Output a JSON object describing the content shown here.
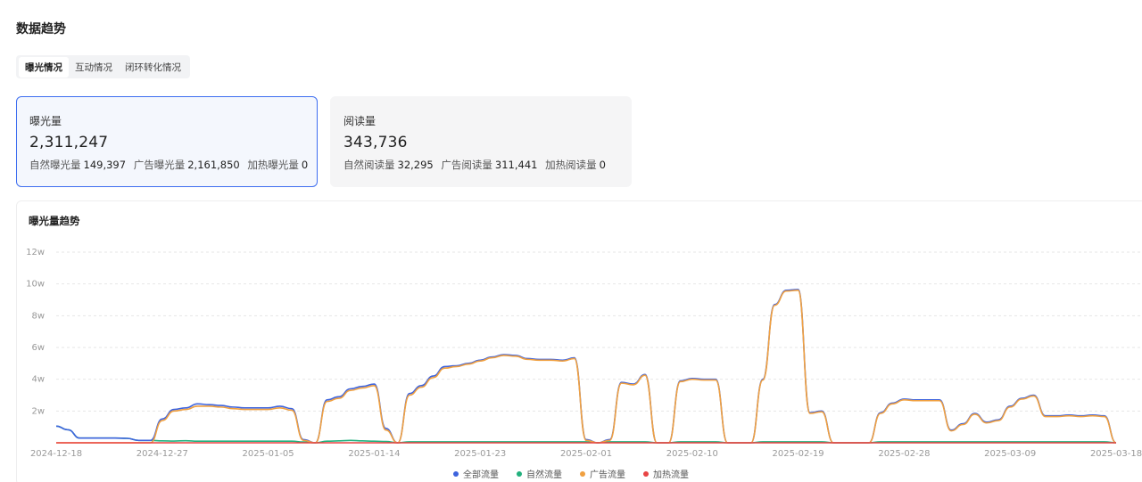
{
  "page": {
    "title": "数据趋势"
  },
  "tabs": [
    {
      "label": "曝光情况",
      "active": true
    },
    {
      "label": "互动情况",
      "active": false
    },
    {
      "label": "闭环转化情况",
      "active": false
    }
  ],
  "cards": [
    {
      "title": "曝光量",
      "value": "2,311,247",
      "breakdown": [
        {
          "label": "自然曝光量",
          "value": "149,397"
        },
        {
          "label": "广告曝光量",
          "value": "2,161,850"
        },
        {
          "label": "加热曝光量",
          "value": "0"
        }
      ]
    },
    {
      "title": "阅读量",
      "value": "343,736",
      "breakdown": [
        {
          "label": "自然阅读量",
          "value": "32,295"
        },
        {
          "label": "广告阅读量",
          "value": "311,441"
        },
        {
          "label": "加热阅读量",
          "value": "0"
        }
      ]
    }
  ],
  "chart_data": {
    "type": "line",
    "title": "曝光量趋势",
    "ylim": [
      0,
      120000
    ],
    "yticks": [
      {
        "v": 20000,
        "label": "2w"
      },
      {
        "v": 40000,
        "label": "4w"
      },
      {
        "v": 60000,
        "label": "6w"
      },
      {
        "v": 80000,
        "label": "8w"
      },
      {
        "v": 100000,
        "label": "10w"
      },
      {
        "v": 120000,
        "label": "12w"
      }
    ],
    "xlabels": [
      "2024-12-18",
      "2024-12-27",
      "2025-01-05",
      "2025-01-14",
      "2025-01-23",
      "2025-02-01",
      "2025-02-10",
      "2025-02-19",
      "2025-02-28",
      "2025-03-09",
      "2025-03-18"
    ],
    "x": [
      "12-18",
      "12-19",
      "12-20",
      "12-21",
      "12-22",
      "12-23",
      "12-24",
      "12-25",
      "12-26",
      "12-27",
      "12-28",
      "12-29",
      "12-30",
      "12-31",
      "01-01",
      "01-02",
      "01-03",
      "01-04",
      "01-05",
      "01-06",
      "01-07",
      "01-08",
      "01-09",
      "01-10",
      "01-11",
      "01-12",
      "01-13",
      "01-14",
      "01-15",
      "01-16",
      "01-17",
      "01-18",
      "01-19",
      "01-20",
      "01-21",
      "01-22",
      "01-23",
      "01-24",
      "01-25",
      "01-26",
      "01-27",
      "01-28",
      "01-29",
      "01-30",
      "01-31",
      "02-01",
      "02-02",
      "02-03",
      "02-04",
      "02-05",
      "02-06",
      "02-07",
      "02-08",
      "02-09",
      "02-10",
      "02-11",
      "02-12",
      "02-13",
      "02-14",
      "02-15",
      "02-16",
      "02-17",
      "02-18",
      "02-19",
      "02-20",
      "02-21",
      "02-22",
      "02-23",
      "02-24",
      "02-25",
      "02-26",
      "02-27",
      "02-28",
      "03-01",
      "03-02",
      "03-03",
      "03-04",
      "03-05",
      "03-06",
      "03-07",
      "03-08",
      "03-09",
      "03-10",
      "03-11",
      "03-12",
      "03-13",
      "03-14",
      "03-15",
      "03-16",
      "03-17",
      "03-18"
    ],
    "series": [
      {
        "name": "全部流量",
        "color": "#3d63dd",
        "values": [
          10500,
          8200,
          3000,
          3000,
          3000,
          3000,
          2800,
          1500,
          1500,
          15000,
          21000,
          22000,
          24500,
          24000,
          23500,
          22500,
          22000,
          22000,
          22000,
          23000,
          21500,
          2000,
          0,
          27000,
          29000,
          34000,
          35500,
          37000,
          9000,
          0,
          31000,
          36000,
          42000,
          48000,
          48500,
          50000,
          52000,
          54000,
          55500,
          55000,
          53000,
          52500,
          52500,
          52000,
          53500,
          2000,
          0,
          2000,
          38000,
          37000,
          43000,
          0,
          0,
          39000,
          40500,
          40000,
          40000,
          0,
          0,
          0,
          40000,
          87000,
          96000,
          96500,
          19000,
          20000,
          0,
          0,
          0,
          0,
          19000,
          25000,
          27500,
          27000,
          27000,
          27000,
          8000,
          12000,
          18500,
          13000,
          14500,
          23000,
          28000,
          30000,
          17000,
          17000,
          17500,
          17000,
          17500,
          17000,
          0
        ]
      },
      {
        "name": "自然流量",
        "color": "#22b07d",
        "values": [
          10500,
          8200,
          3000,
          3000,
          3000,
          3000,
          2800,
          1500,
          1500,
          1200,
          1100,
          1300,
          1000,
          1000,
          1000,
          1000,
          1000,
          1000,
          1000,
          1000,
          1000,
          500,
          0,
          1000,
          1200,
          1500,
          1200,
          1000,
          800,
          0,
          600,
          600,
          600,
          600,
          600,
          600,
          600,
          600,
          600,
          600,
          600,
          600,
          600,
          600,
          600,
          600,
          0,
          600,
          600,
          600,
          600,
          0,
          0,
          600,
          600,
          600,
          600,
          0,
          0,
          0,
          600,
          600,
          600,
          600,
          600,
          600,
          0,
          0,
          0,
          0,
          600,
          600,
          600,
          600,
          600,
          600,
          600,
          600,
          600,
          600,
          600,
          600,
          600,
          600,
          600,
          600,
          600,
          600,
          600,
          600,
          0
        ]
      },
      {
        "name": "广告流量",
        "color": "#f0a040",
        "values": [
          0,
          0,
          0,
          0,
          0,
          0,
          0,
          0,
          0,
          14000,
          20000,
          21000,
          23000,
          23000,
          22500,
          21500,
          21000,
          21000,
          21000,
          22000,
          20500,
          1500,
          0,
          26000,
          28000,
          33000,
          34500,
          36000,
          8000,
          0,
          30000,
          35000,
          41000,
          47000,
          48000,
          49500,
          51500,
          53500,
          55000,
          54500,
          52500,
          52000,
          52000,
          51500,
          53000,
          1500,
          0,
          1500,
          37500,
          36500,
          42500,
          0,
          0,
          38500,
          40000,
          39500,
          39500,
          0,
          0,
          0,
          39500,
          86500,
          95500,
          96000,
          18500,
          19500,
          0,
          0,
          0,
          0,
          18500,
          24500,
          27000,
          26500,
          26500,
          26500,
          7500,
          11500,
          18000,
          12500,
          14000,
          22500,
          27500,
          29500,
          16500,
          16500,
          17000,
          16500,
          17000,
          16500,
          0
        ]
      },
      {
        "name": "加热流量",
        "color": "#e84444",
        "values": [
          0,
          0,
          0,
          0,
          0,
          0,
          0,
          0,
          0,
          0,
          0,
          0,
          0,
          0,
          0,
          0,
          0,
          0,
          0,
          0,
          0,
          0,
          0,
          0,
          0,
          0,
          0,
          0,
          0,
          0,
          0,
          0,
          0,
          0,
          0,
          0,
          0,
          0,
          0,
          0,
          0,
          0,
          0,
          0,
          0,
          0,
          0,
          0,
          0,
          0,
          0,
          0,
          0,
          0,
          0,
          0,
          0,
          0,
          0,
          0,
          0,
          0,
          0,
          0,
          0,
          0,
          0,
          0,
          0,
          0,
          0,
          0,
          0,
          0,
          0,
          0,
          0,
          0,
          0,
          0,
          0,
          0,
          0,
          0,
          0,
          0,
          0,
          0,
          0,
          0,
          0
        ]
      }
    ],
    "grid": true,
    "legend_position": "bottom"
  }
}
